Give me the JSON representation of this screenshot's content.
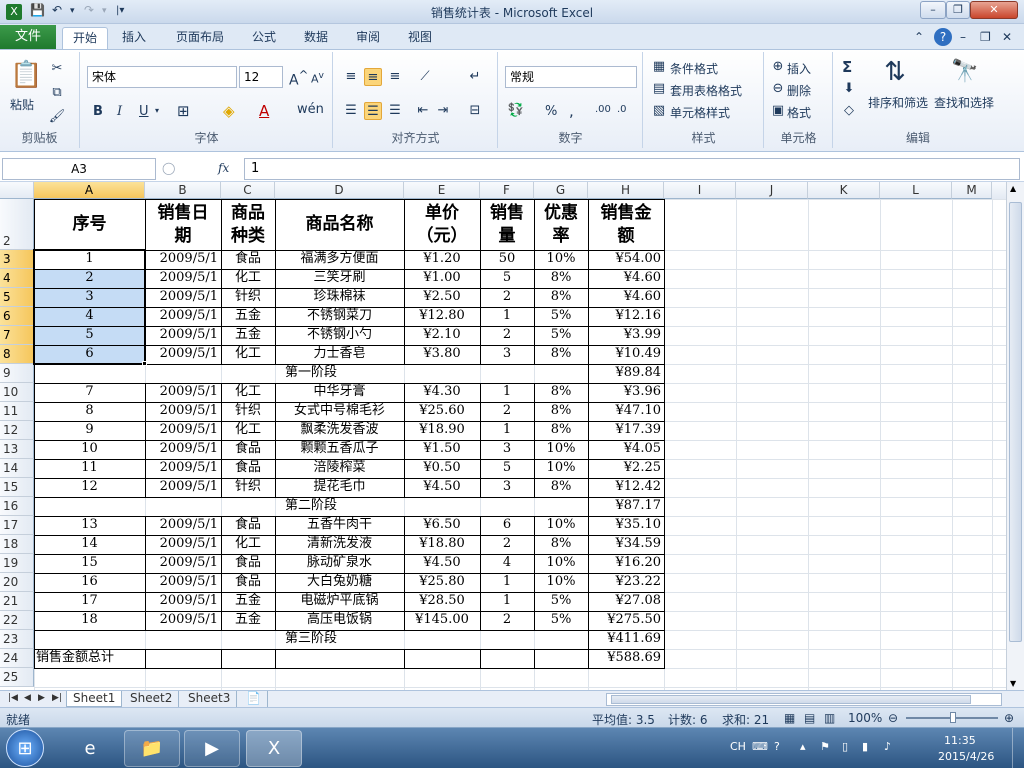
{
  "window": {
    "title": "销售统计表 - Microsoft Excel"
  },
  "ribbon": {
    "file_tab": "文件",
    "tabs": [
      "开始",
      "插入",
      "页面布局",
      "公式",
      "数据",
      "审阅",
      "视图"
    ],
    "clipboard": {
      "paste": "粘贴",
      "label": "剪贴板"
    },
    "font": {
      "name": "宋体",
      "size": "12",
      "label": "字体",
      "bold": "B",
      "italic": "I",
      "underline": "U"
    },
    "alignment": {
      "label": "对齐方式"
    },
    "number": {
      "format": "常规",
      "label": "数字",
      "percent": "%",
      "comma": ","
    },
    "styles": {
      "conditional": "条件格式",
      "table": "套用表格格式",
      "cell": "单元格样式",
      "label": "样式"
    },
    "cells": {
      "insert": "插入",
      "delete": "删除",
      "format": "格式",
      "label": "单元格"
    },
    "editing": {
      "sort": "排序和筛选",
      "find": "查找和选择",
      "label": "编辑",
      "sum": "Σ"
    }
  },
  "formula_bar": {
    "name_box": "A3",
    "fx": "fx",
    "value": "1"
  },
  "columns": [
    "A",
    "B",
    "C",
    "D",
    "E",
    "F",
    "G",
    "H",
    "I",
    "J",
    "K",
    "L",
    "M"
  ],
  "rows": [
    "1",
    "2",
    "3",
    "4",
    "5",
    "6",
    "7",
    "8",
    "9",
    "10",
    "11",
    "12",
    "13",
    "14",
    "15",
    "16",
    "17",
    "18",
    "19",
    "20",
    "21",
    "22",
    "23",
    "24",
    "25"
  ],
  "header": {
    "a": "序号",
    "b1": "销售日",
    "b2": "期",
    "c1": "商品",
    "c2": "种类",
    "d": "商品名称",
    "e1": "单价",
    "e2": "（元）",
    "f1": "销售",
    "f2": "量",
    "g1": "优惠",
    "g2": "率",
    "h1": "销售金",
    "h2": "额"
  },
  "data": [
    {
      "a": "1",
      "b": "2009/5/1",
      "c": "食品",
      "d": "福满多方便面",
      "e": "¥1.20",
      "f": "50",
      "g": "10%",
      "h": "¥54.00"
    },
    {
      "a": "2",
      "b": "2009/5/1",
      "c": "化工",
      "d": "三笑牙刷",
      "e": "¥1.00",
      "f": "5",
      "g": "8%",
      "h": "¥4.60"
    },
    {
      "a": "3",
      "b": "2009/5/1",
      "c": "针织",
      "d": "珍珠棉袜",
      "e": "¥2.50",
      "f": "2",
      "g": "8%",
      "h": "¥4.60"
    },
    {
      "a": "4",
      "b": "2009/5/1",
      "c": "五金",
      "d": "不锈钢菜刀",
      "e": "¥12.80",
      "f": "1",
      "g": "5%",
      "h": "¥12.16"
    },
    {
      "a": "5",
      "b": "2009/5/1",
      "c": "五金",
      "d": "不锈钢小勺",
      "e": "¥2.10",
      "f": "2",
      "g": "5%",
      "h": "¥3.99"
    },
    {
      "a": "6",
      "b": "2009/5/1",
      "c": "化工",
      "d": "力士香皂",
      "e": "¥3.80",
      "f": "3",
      "g": "8%",
      "h": "¥10.49"
    },
    {
      "merged": "第一阶段",
      "h": "¥89.84"
    },
    {
      "a": "7",
      "b": "2009/5/1",
      "c": "化工",
      "d": "中华牙膏",
      "e": "¥4.30",
      "f": "1",
      "g": "8%",
      "h": "¥3.96"
    },
    {
      "a": "8",
      "b": "2009/5/1",
      "c": "针织",
      "d": "女式中号棉毛衫",
      "e": "¥25.60",
      "f": "2",
      "g": "8%",
      "h": "¥47.10"
    },
    {
      "a": "9",
      "b": "2009/5/1",
      "c": "化工",
      "d": "飘柔洗发香波",
      "e": "¥18.90",
      "f": "1",
      "g": "8%",
      "h": "¥17.39"
    },
    {
      "a": "10",
      "b": "2009/5/1",
      "c": "食品",
      "d": "颗颗五香瓜子",
      "e": "¥1.50",
      "f": "3",
      "g": "10%",
      "h": "¥4.05"
    },
    {
      "a": "11",
      "b": "2009/5/1",
      "c": "食品",
      "d": "涪陵榨菜",
      "e": "¥0.50",
      "f": "5",
      "g": "10%",
      "h": "¥2.25"
    },
    {
      "a": "12",
      "b": "2009/5/1",
      "c": "针织",
      "d": "提花毛巾",
      "e": "¥4.50",
      "f": "3",
      "g": "8%",
      "h": "¥12.42"
    },
    {
      "merged": "第二阶段",
      "h": "¥87.17"
    },
    {
      "a": "13",
      "b": "2009/5/1",
      "c": "食品",
      "d": "五香牛肉干",
      "e": "¥6.50",
      "f": "6",
      "g": "10%",
      "h": "¥35.10"
    },
    {
      "a": "14",
      "b": "2009/5/1",
      "c": "化工",
      "d": "清新洗发液",
      "e": "¥18.80",
      "f": "2",
      "g": "8%",
      "h": "¥34.59"
    },
    {
      "a": "15",
      "b": "2009/5/1",
      "c": "食品",
      "d": "脉动矿泉水",
      "e": "¥4.50",
      "f": "4",
      "g": "10%",
      "h": "¥16.20"
    },
    {
      "a": "16",
      "b": "2009/5/1",
      "c": "食品",
      "d": "大白兔奶糖",
      "e": "¥25.80",
      "f": "1",
      "g": "10%",
      "h": "¥23.22"
    },
    {
      "a": "17",
      "b": "2009/5/1",
      "c": "五金",
      "d": "电磁炉平底锅",
      "e": "¥28.50",
      "f": "1",
      "g": "5%",
      "h": "¥27.08"
    },
    {
      "a": "18",
      "b": "2009/5/1",
      "c": "五金",
      "d": "高压电饭锅",
      "e": "¥145.00",
      "f": "2",
      "g": "5%",
      "h": "¥275.50"
    },
    {
      "merged": "第三阶段",
      "h": "¥411.69"
    },
    {
      "total": "销售金额总计",
      "h": "¥588.69"
    }
  ],
  "sheet_tabs": [
    "Sheet1",
    "Sheet2",
    "Sheet3"
  ],
  "status": {
    "ready": "就绪",
    "average": "平均值: 3.5",
    "count": "计数: 6",
    "sum": "求和: 21",
    "zoom": "100%"
  },
  "taskbar": {
    "lang": "CH",
    "time": "11:35",
    "date": "2015/4/26"
  },
  "colors": {
    "selection": "#c5dcf5",
    "header_selected": "#f6c65c",
    "file_tab": "#1f7a2e"
  }
}
